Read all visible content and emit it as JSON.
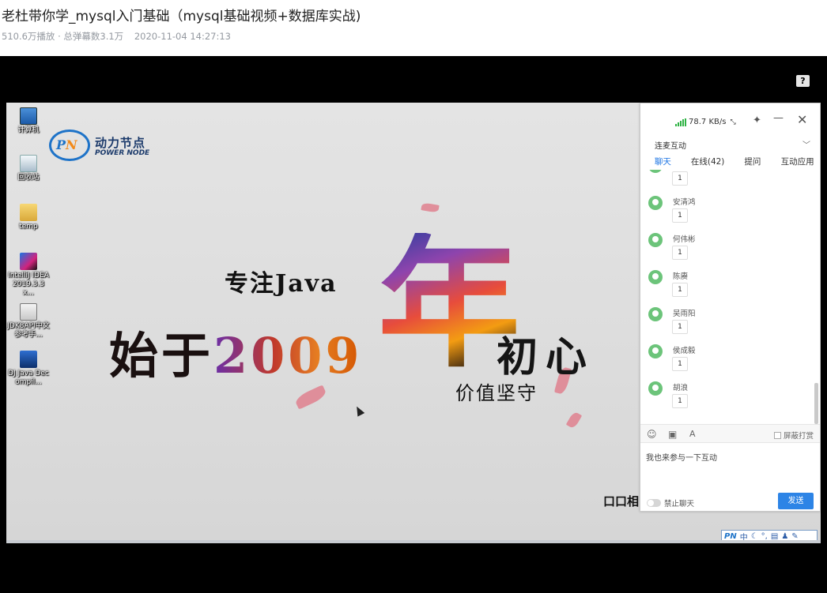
{
  "video": {
    "title": "老杜带你学_mysql入门基础（mysql基础视频+数据库实战)",
    "plays": "510.6万播放",
    "danmaku": "总弹幕数3.1万",
    "date": "2020-11-04 14:27:13"
  },
  "player": {
    "help_label": "?"
  },
  "desktop_icons": [
    {
      "label": "计算机",
      "icon": "computer-icon"
    },
    {
      "label": "回收站",
      "icon": "recycle-bin-icon"
    },
    {
      "label": "temp",
      "icon": "folder-icon"
    },
    {
      "label": "IntelliJ IDEA 2019.3.3 x...",
      "icon": "intellij-icon"
    },
    {
      "label": "JDK8API中文参考手...",
      "icon": "help-file-icon"
    },
    {
      "label": "DJ Java Decompil...",
      "icon": "decompiler-icon"
    }
  ],
  "logo": {
    "mark_p": "P",
    "mark_n": "N",
    "cn": "动力节点",
    "en": "POWER NODE"
  },
  "slide": {
    "focus": "专注Java",
    "since": "始于",
    "year": "2009",
    "nian": "年",
    "chuxin": "初心",
    "value": "价值坚守",
    "partial": "口口相"
  },
  "chat": {
    "speed": "78.7 KB/s",
    "mode": "连麦互动",
    "tabs": [
      "聊天",
      "在线(42)",
      "提问",
      "互动应用"
    ],
    "messages": [
      {
        "name": "安清鸿",
        "text": "1"
      },
      {
        "name": "何伟彬",
        "text": "1"
      },
      {
        "name": "陈赓",
        "text": "1"
      },
      {
        "name": "吴雨阳",
        "text": "1"
      },
      {
        "name": "侯成毅",
        "text": "1"
      },
      {
        "name": "胡浪",
        "text": "1"
      }
    ],
    "partial_msg": "1",
    "block_label": "屏蔽打赏",
    "input_placeholder": "我也来参与一下互动",
    "mute_label": "禁止聊天",
    "send_label": "发送"
  },
  "tray": {
    "ime": "中"
  }
}
